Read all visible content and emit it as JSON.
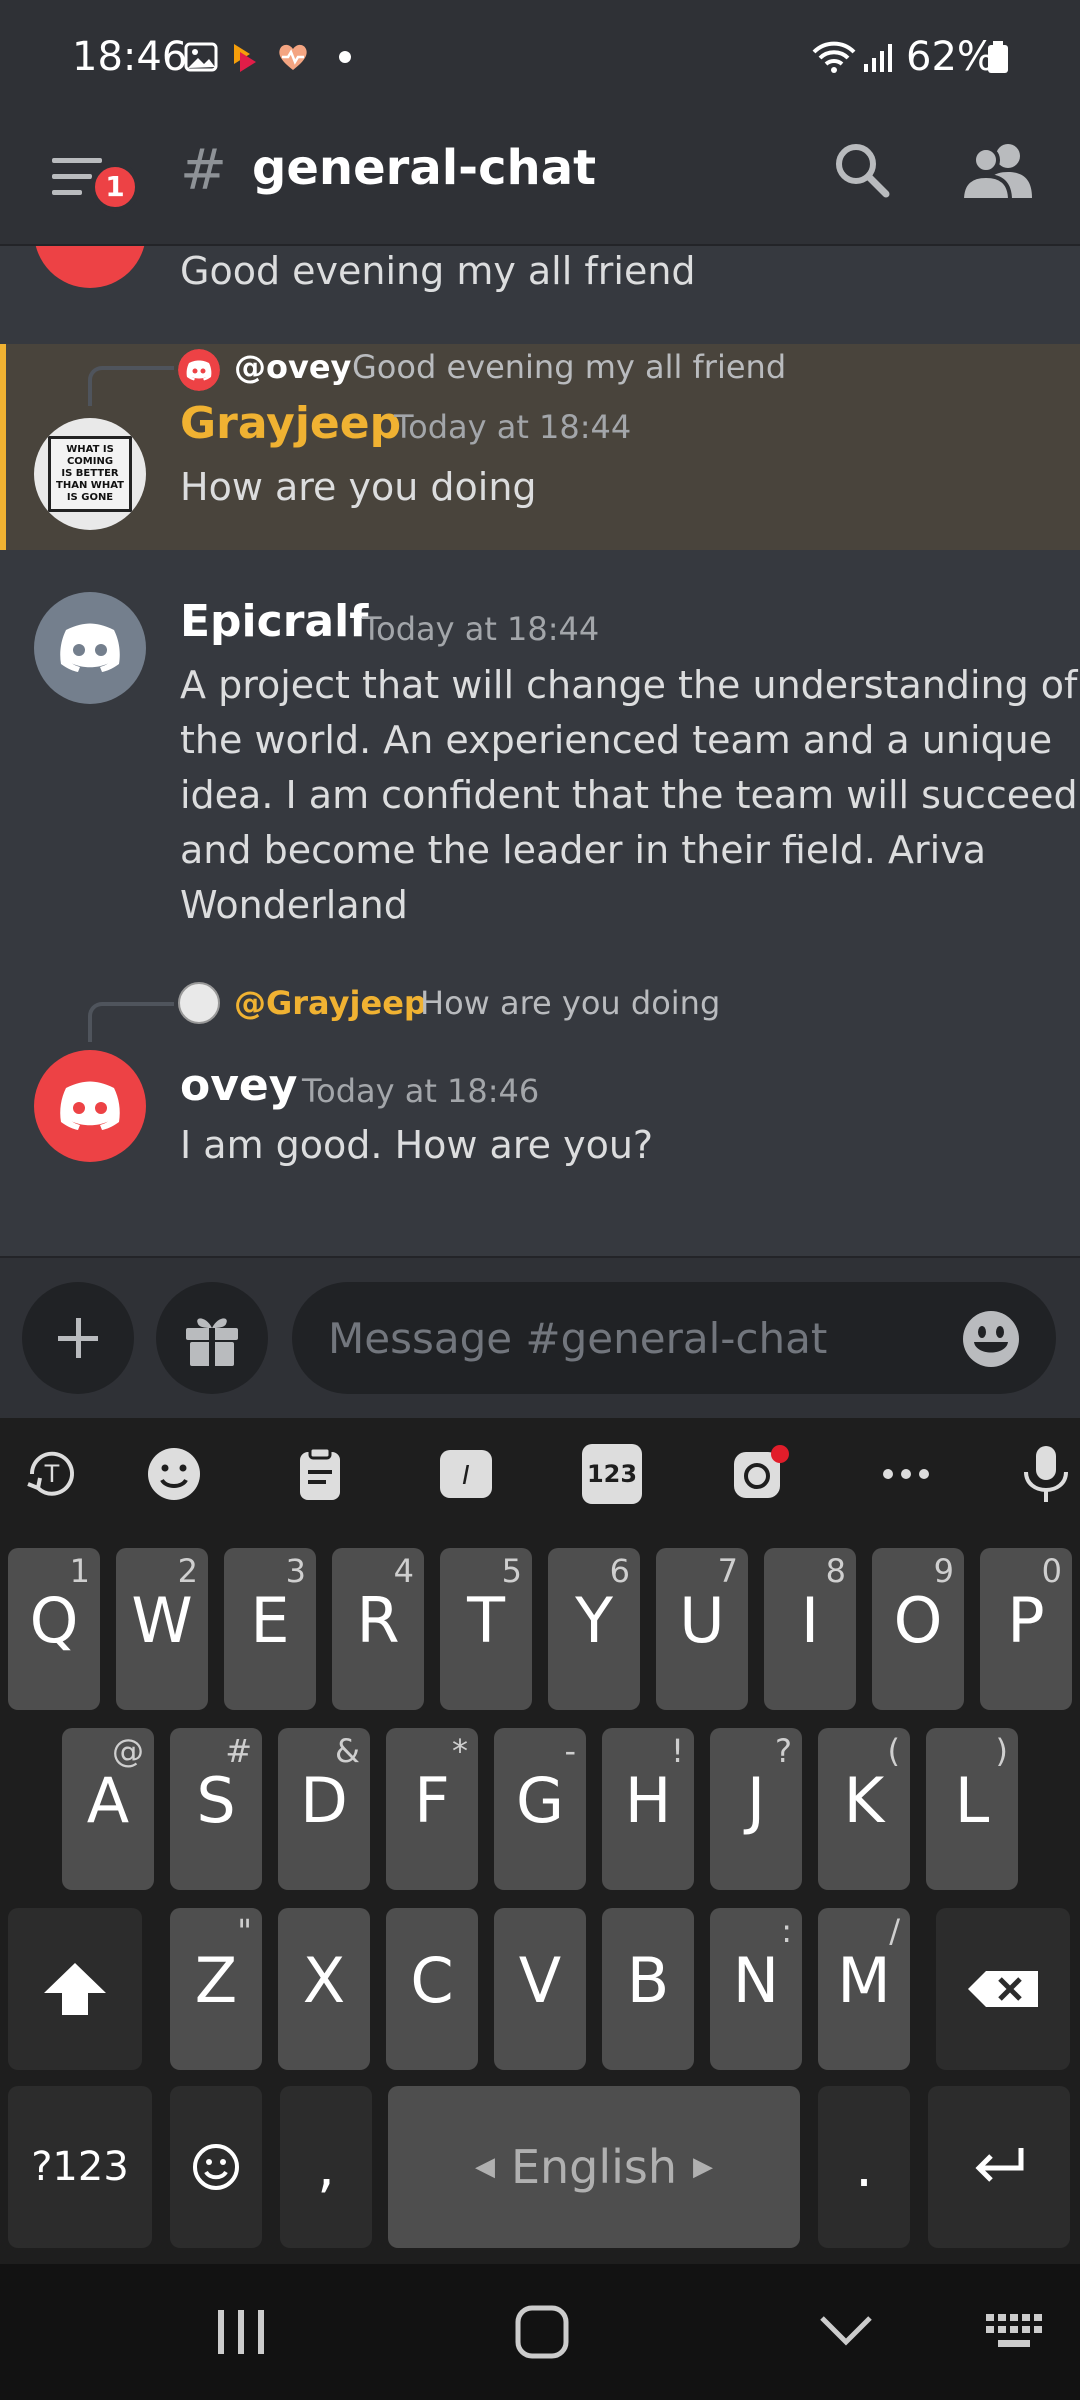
{
  "status_bar": {
    "time": "18:46",
    "battery": "62%",
    "notification_icons": [
      "gallery-icon",
      "app-icon",
      "health-icon",
      "dot-icon"
    ],
    "system_icons": [
      "wifi-icon",
      "signal-icon",
      "battery-icon"
    ]
  },
  "header": {
    "menu_badge": "1",
    "hash": "#",
    "channel_name": "general-chat",
    "icons": [
      "hamburger-menu-icon",
      "search-icon",
      "members-icon"
    ]
  },
  "messages": {
    "partial": {
      "text": "Good evening my all friend"
    },
    "grayjeep": {
      "reply_name": "@ovey",
      "reply_text": "Good evening my all friend",
      "author": "Grayjeep",
      "time": "Today at 18:44",
      "text": "How are you doing",
      "avatar_lines": [
        "WHAT IS",
        "COMING",
        "IS BETTER",
        "THAN WHAT",
        "IS GONE"
      ]
    },
    "epicralf": {
      "author": "Epicralf",
      "time": "Today at 18:44",
      "lines": [
        "A project that will change the understanding of",
        "the world. An experienced team and a unique",
        "idea. I am confident that the team will succeed",
        "and become the leader in their field. Ariva",
        "Wonderland"
      ]
    },
    "ovey": {
      "reply_name": "@Grayjeep",
      "reply_text": "How are you doing",
      "author": "ovey",
      "time": "Today at 18:46",
      "text": "I am good. How are you?"
    }
  },
  "composer": {
    "placeholder": "Message #general-chat",
    "icons": [
      "plus-icon",
      "gift-icon",
      "emoji-icon"
    ]
  },
  "keyboard": {
    "toolbar_icons": [
      "translate-icon",
      "emoji-icon",
      "clipboard-icon",
      "text-edit-icon",
      "numpad-icon",
      "sticker-icon",
      "more-icon",
      "microphone-icon"
    ],
    "toolbar_numpad_label": "123",
    "row1": [
      {
        "k": "Q",
        "h": "1"
      },
      {
        "k": "W",
        "h": "2"
      },
      {
        "k": "E",
        "h": "3"
      },
      {
        "k": "R",
        "h": "4"
      },
      {
        "k": "T",
        "h": "5"
      },
      {
        "k": "Y",
        "h": "6"
      },
      {
        "k": "U",
        "h": "7"
      },
      {
        "k": "I",
        "h": "8"
      },
      {
        "k": "O",
        "h": "9"
      },
      {
        "k": "P",
        "h": "0"
      }
    ],
    "row2": [
      {
        "k": "A",
        "h": "@"
      },
      {
        "k": "S",
        "h": "#"
      },
      {
        "k": "D",
        "h": "&"
      },
      {
        "k": "F",
        "h": "*"
      },
      {
        "k": "G",
        "h": "-"
      },
      {
        "k": "H",
        "h": "!"
      },
      {
        "k": "J",
        "h": "?"
      },
      {
        "k": "K",
        "h": "("
      },
      {
        "k": "L",
        "h": ")"
      }
    ],
    "row3": [
      {
        "k": "Z",
        "h": "\""
      },
      {
        "k": "X",
        "h": ""
      },
      {
        "k": "C",
        "h": ""
      },
      {
        "k": "V",
        "h": ""
      },
      {
        "k": "B",
        "h": ""
      },
      {
        "k": "N",
        "h": ":"
      },
      {
        "k": "M",
        "h": "/"
      }
    ],
    "sym_label": "?123",
    "comma": ",",
    "space_label": "English",
    "period": "."
  },
  "navbar": {
    "icons": [
      "recent-apps-icon",
      "home-icon",
      "back-icon",
      "keyboard-icon"
    ]
  },
  "colors": {
    "accent_yellow": "#f0b232",
    "discord_red": "#ed4245",
    "background": "#36393f"
  }
}
